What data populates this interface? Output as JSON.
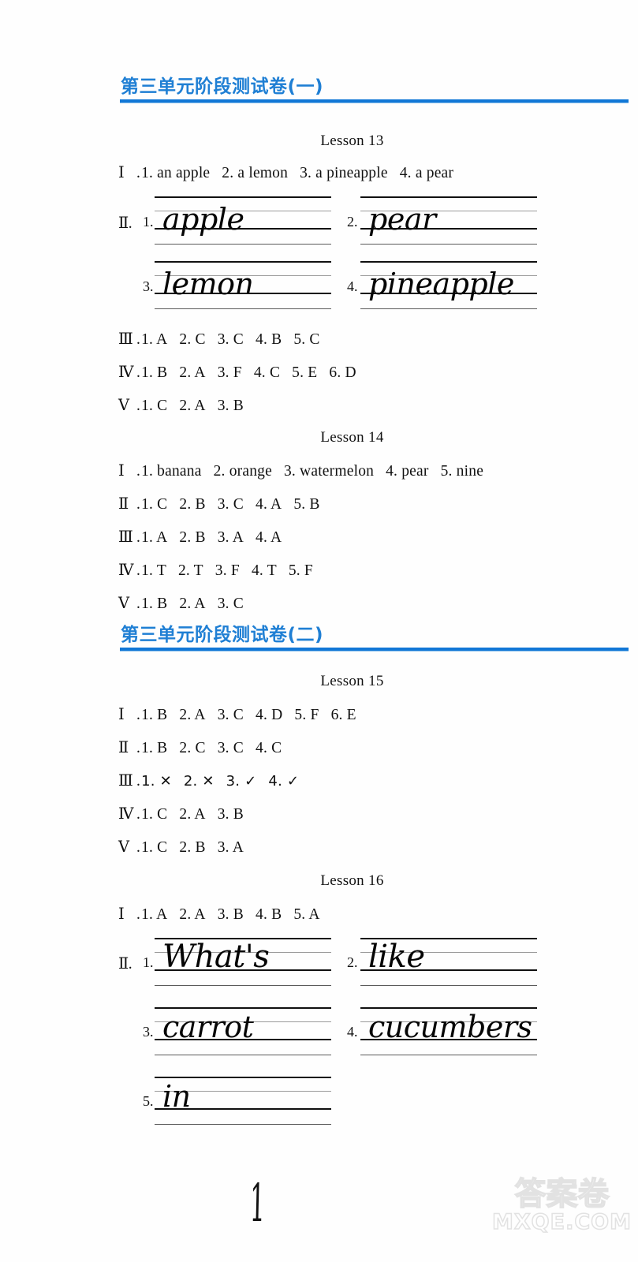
{
  "sections": [
    {
      "title": "第三单元阶段测试卷(一)"
    },
    {
      "title": "第三单元阶段测试卷(二)"
    }
  ],
  "lessons": [
    {
      "title": "Lesson 13",
      "rows": [
        {
          "rn": "Ⅰ",
          "items": [
            "1. an apple",
            "2. a lemon",
            "3. a pineapple",
            "4. a pear"
          ]
        },
        {
          "rn": "Ⅲ",
          "items": [
            "1. A",
            "2. C",
            "3. C",
            "4. B",
            "5. C"
          ]
        },
        {
          "rn": "Ⅳ",
          "items": [
            "1. B",
            "2. A",
            "3. F",
            "4. C",
            "5. E",
            "6. D"
          ]
        },
        {
          "rn": "Ⅴ",
          "items": [
            "1. C",
            "2. A",
            "3. B"
          ]
        }
      ],
      "writing": {
        "rn": "Ⅱ",
        "entries": [
          {
            "num": "1.",
            "word": "apple"
          },
          {
            "num": "2.",
            "word": "pear"
          },
          {
            "num": "3.",
            "word": "lemon"
          },
          {
            "num": "4.",
            "word": "pineapple"
          }
        ]
      }
    },
    {
      "title": "Lesson 14",
      "rows": [
        {
          "rn": "Ⅰ",
          "items": [
            "1. banana",
            "2. orange",
            "3. watermelon",
            "4. pear",
            "5. nine"
          ]
        },
        {
          "rn": "Ⅱ",
          "items": [
            "1. C",
            "2. B",
            "3. C",
            "4. A",
            "5. B"
          ]
        },
        {
          "rn": "Ⅲ",
          "items": [
            "1. A",
            "2. B",
            "3. A",
            "4. A"
          ]
        },
        {
          "rn": "Ⅳ",
          "items": [
            "1. T",
            "2. T",
            "3. F",
            "4. T",
            "5. F"
          ]
        },
        {
          "rn": "Ⅴ",
          "items": [
            "1. B",
            "2. A",
            "3. C"
          ]
        }
      ]
    },
    {
      "title": "Lesson 15",
      "rows": [
        {
          "rn": "Ⅰ",
          "items": [
            "1. B",
            "2. A",
            "3. C",
            "4. D",
            "5. F",
            "6. E"
          ]
        },
        {
          "rn": "Ⅱ",
          "items": [
            "1. B",
            "2. C",
            "3. C",
            "4. C"
          ]
        },
        {
          "rn": "Ⅲ",
          "items": [
            "1. ✕",
            "2. ✕",
            "3. ✓",
            "4. ✓"
          ]
        },
        {
          "rn": "Ⅳ",
          "items": [
            "1. C",
            "2. A",
            "3. B"
          ]
        },
        {
          "rn": "Ⅴ",
          "items": [
            "1. C",
            "2. B",
            "3. A"
          ]
        }
      ]
    },
    {
      "title": "Lesson 16",
      "rows": [
        {
          "rn": "Ⅰ",
          "items": [
            "1. A",
            "2. A",
            "3. B",
            "4. B",
            "5. A"
          ]
        }
      ],
      "writing": {
        "rn": "Ⅱ",
        "entries": [
          {
            "num": "1.",
            "word": "What's"
          },
          {
            "num": "2.",
            "word": "like"
          },
          {
            "num": "3.",
            "word": "carrot"
          },
          {
            "num": "4.",
            "word": "cucumbers"
          },
          {
            "num": "5.",
            "word": "in"
          }
        ]
      }
    }
  ],
  "page_number": "1",
  "watermark": {
    "cn": "答案卷",
    "en": "MXQE.COM"
  },
  "colors": {
    "header_blue": "#1f7fd4",
    "rule_blue": "#1177d6",
    "text": "#101010"
  }
}
